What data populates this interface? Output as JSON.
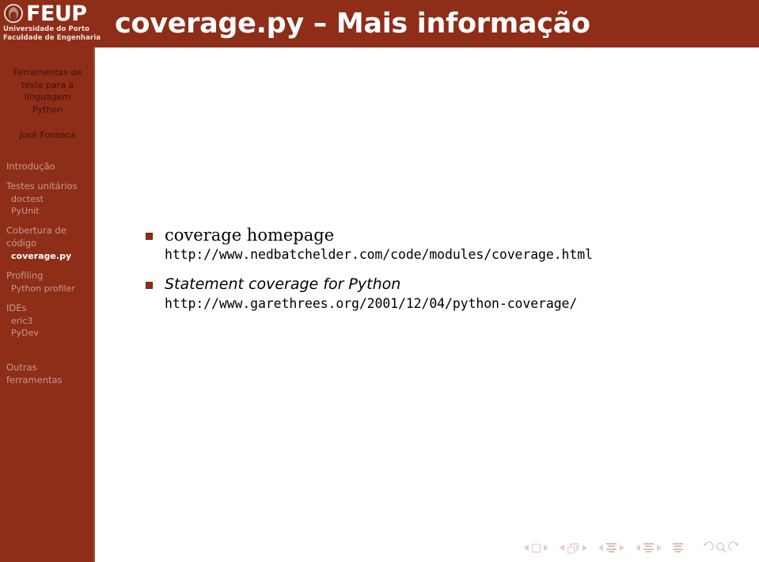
{
  "header": {
    "logo": {
      "crest_icon": "feup-crest-icon",
      "wordmark": "FEUP",
      "sub_line_1": "Universidade do Porto",
      "sub_line_2": "Faculdade de Engenharia"
    },
    "title": "coverage.py – Mais informação",
    "bg_color": "#8E2D18"
  },
  "sidebar": {
    "bg_color": "#8E2D18",
    "divider_color": "#a84a33",
    "title_lines": [
      "Ferramentas de",
      "teste para a",
      "linguagem",
      "Python"
    ],
    "author_lines": [
      "José Fonseca"
    ],
    "groups": [
      {
        "section": "Introdução",
        "section_lines": [
          "Introdução"
        ],
        "items": []
      },
      {
        "section": "Testes unitários",
        "section_lines": [
          "Testes unitários"
        ],
        "items": [
          {
            "label": "doctest",
            "active": false
          },
          {
            "label": "PyUnit",
            "active": false
          }
        ]
      },
      {
        "section": "Cobertura de código",
        "section_lines": [
          "Cobertura de",
          "código"
        ],
        "items": [
          {
            "label": "coverage.py",
            "active": true
          }
        ]
      },
      {
        "section": "Profiling",
        "section_lines": [
          "Profiling"
        ],
        "items": [
          {
            "label": "Python profiler",
            "active": false
          }
        ]
      },
      {
        "section": "IDEs",
        "section_lines": [
          "IDEs"
        ],
        "items": [
          {
            "label": "eric3",
            "active": false
          },
          {
            "label": "PyDev",
            "active": false
          }
        ]
      },
      {
        "section": "Outras ferramentas",
        "section_lines": [
          "Outras",
          "ferramentas"
        ],
        "items": []
      }
    ],
    "active_item": "coverage.py",
    "active_color": "#ffffff",
    "inactive_color": "#c39b90",
    "title_color": "#3c1208"
  },
  "content": {
    "bullet_marker_color": "#8E2D18",
    "bullets": [
      {
        "label": "coverage homepage",
        "label_style": "serif",
        "url": "http://www.nedbatchelder.com/code/modules/coverage.html"
      },
      {
        "label": "Statement coverage for Python",
        "label_style": "italic-sans",
        "url": "http://www.garethrees.org/2001/12/04/python-coverage/"
      }
    ]
  },
  "footer": {
    "nav_symbol_color": "#e2cdc6",
    "symbols": [
      {
        "icon": "previous-slide-arrow-icon",
        "kind": "tri-left"
      },
      {
        "icon": "slide-square-icon",
        "kind": "square"
      },
      {
        "icon": "next-slide-arrow-icon",
        "kind": "tri-right"
      },
      {
        "icon": "previous-frame-arrow-icon",
        "kind": "tri-left"
      },
      {
        "icon": "frame-stack-icon",
        "kind": "frames"
      },
      {
        "icon": "next-frame-arrow-icon",
        "kind": "tri-right"
      },
      {
        "icon": "previous-subsection-arrow-icon",
        "kind": "tri-left"
      },
      {
        "icon": "subsection-lines-icon",
        "kind": "lines"
      },
      {
        "icon": "next-subsection-arrow-icon",
        "kind": "tri-right"
      },
      {
        "icon": "previous-section-arrow-icon",
        "kind": "tri-left"
      },
      {
        "icon": "section-lines-icon",
        "kind": "lines"
      },
      {
        "icon": "next-section-arrow-icon",
        "kind": "tri-right"
      },
      {
        "icon": "presentation-lines-icon",
        "kind": "lines"
      },
      {
        "icon": "back-arrow-icon",
        "kind": "back"
      },
      {
        "icon": "search-magnifier-icon",
        "kind": "search"
      },
      {
        "icon": "forward-arrow-icon",
        "kind": "forward"
      }
    ]
  }
}
